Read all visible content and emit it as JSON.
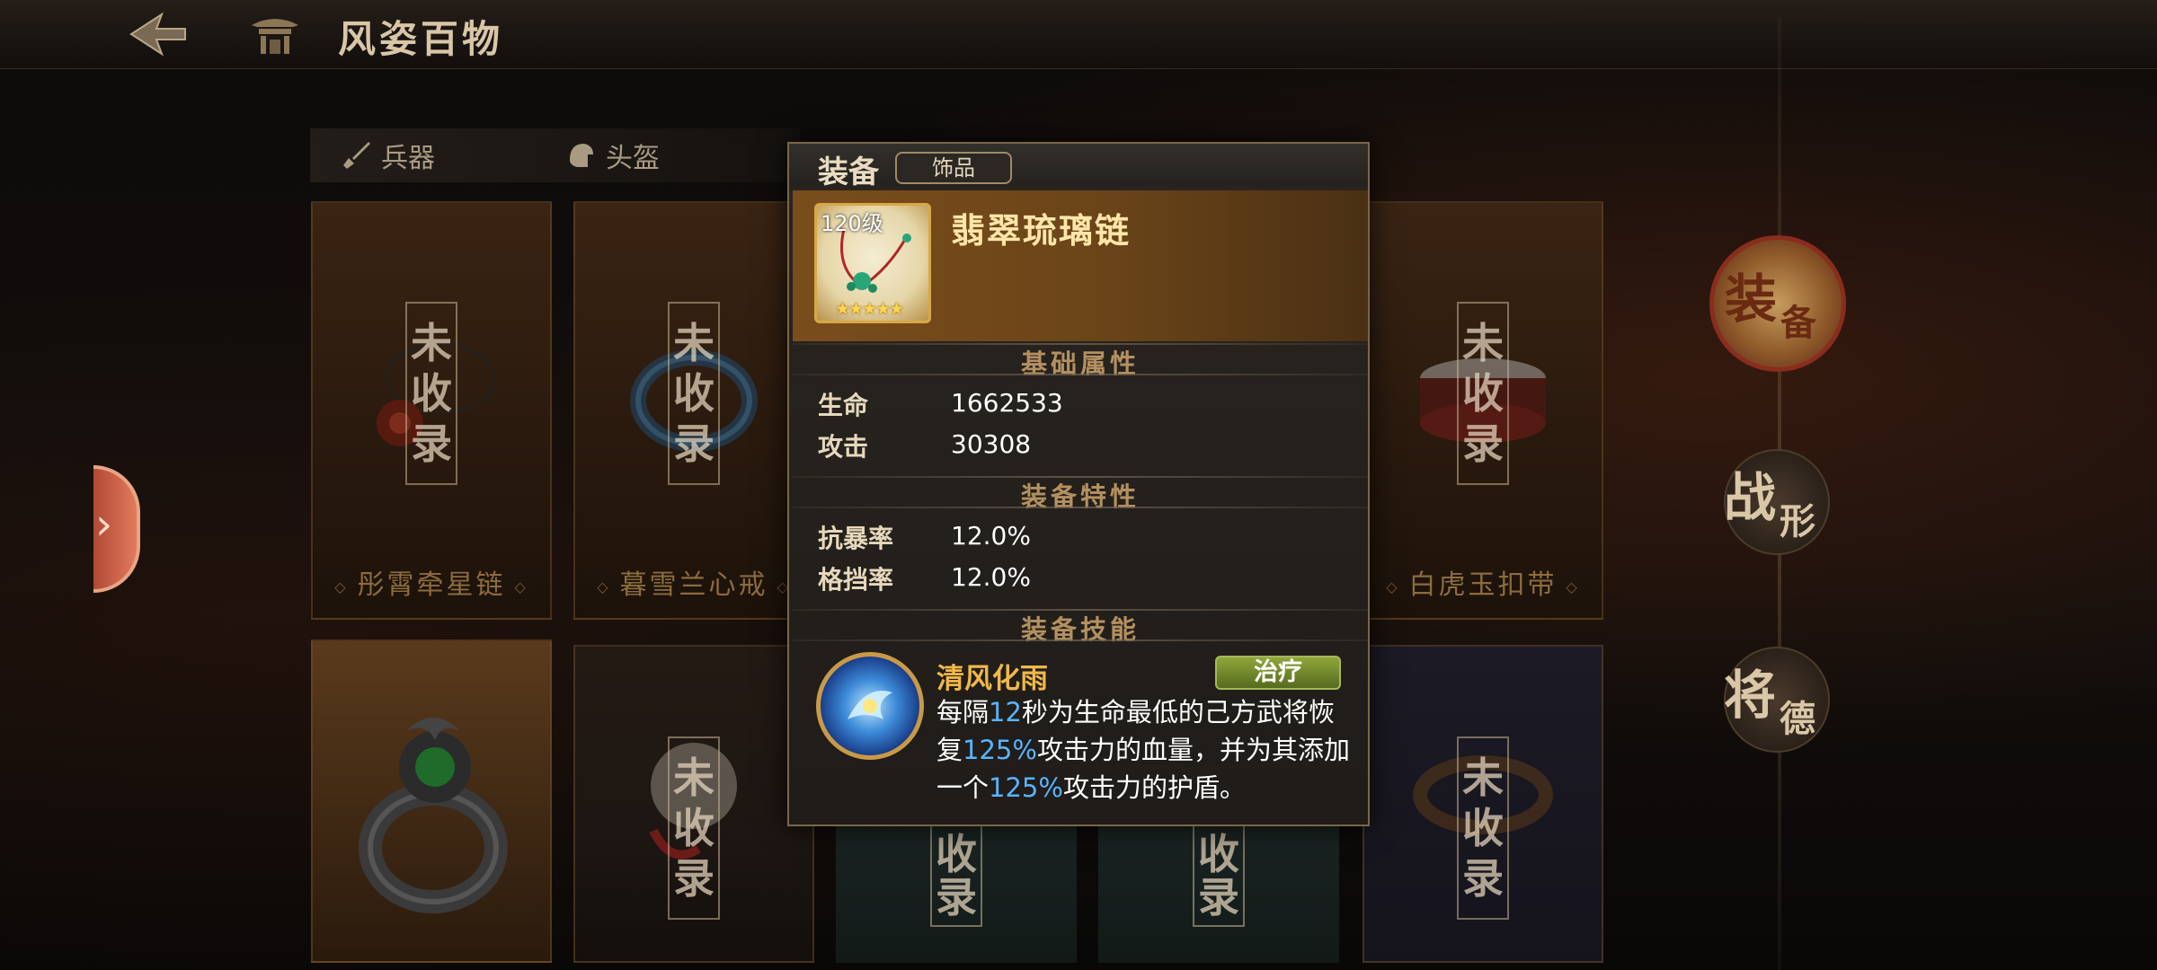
{
  "header": {
    "title": "风姿百物",
    "back_icon": "back-arrow-icon",
    "emblem_icon": "pavilion-icon"
  },
  "tabs": [
    {
      "label": "兵器",
      "icon": "sword-icon"
    },
    {
      "label": "头盔",
      "icon": "helmet-icon"
    }
  ],
  "cards_top": [
    {
      "name": "彤霄牵星链",
      "stamp": [
        "未",
        "收",
        "录"
      ]
    },
    {
      "name": "暮雪兰心戒",
      "stamp": [
        "未",
        "收",
        "录"
      ]
    },
    {
      "name": "白虎玉扣带",
      "stamp": [
        "未",
        "收",
        "录"
      ]
    }
  ],
  "cards_bottom": [
    {
      "stamp": [
        "未",
        "收",
        "录"
      ]
    },
    {
      "stamp": [
        "收",
        "录"
      ]
    },
    {
      "stamp": [
        "收",
        "录"
      ]
    },
    {
      "stamp": [
        "未",
        "收",
        "录"
      ]
    }
  ],
  "side_nav": [
    {
      "big": "装",
      "small": "备",
      "active": true
    },
    {
      "big": "战",
      "small": "形",
      "active": false
    },
    {
      "big": "将",
      "small": "德",
      "active": false
    }
  ],
  "popup": {
    "kind": "装备",
    "subtype": "饰品",
    "item": {
      "level": "120级",
      "name": "翡翠琉璃链",
      "stars": 5
    },
    "base_attr_title": "基础属性",
    "base_attrs": [
      {
        "label": "生命",
        "value": "1662533"
      },
      {
        "label": "攻击",
        "value": "30308"
      }
    ],
    "traits_title": "装备特性",
    "traits": [
      {
        "label": "抗暴率",
        "value": "12.0%"
      },
      {
        "label": "格挡率",
        "value": "12.0%"
      }
    ],
    "skill_title": "装备技能",
    "skill": {
      "name": "清风化雨",
      "tag": "治疗",
      "desc": {
        "p1": "每隔",
        "n1": "12",
        "p2": "秒为生命最低的己方武将恢复",
        "n2": "125%",
        "p3": "攻击力的血量，并为其添加一个",
        "n3": "125%",
        "p4": "攻击力的护盾。"
      }
    }
  },
  "colors": {
    "accent_gold": "#f0b84a",
    "highlight_blue": "#5ab4ff",
    "heal_tag_green": "#8fa63c"
  }
}
